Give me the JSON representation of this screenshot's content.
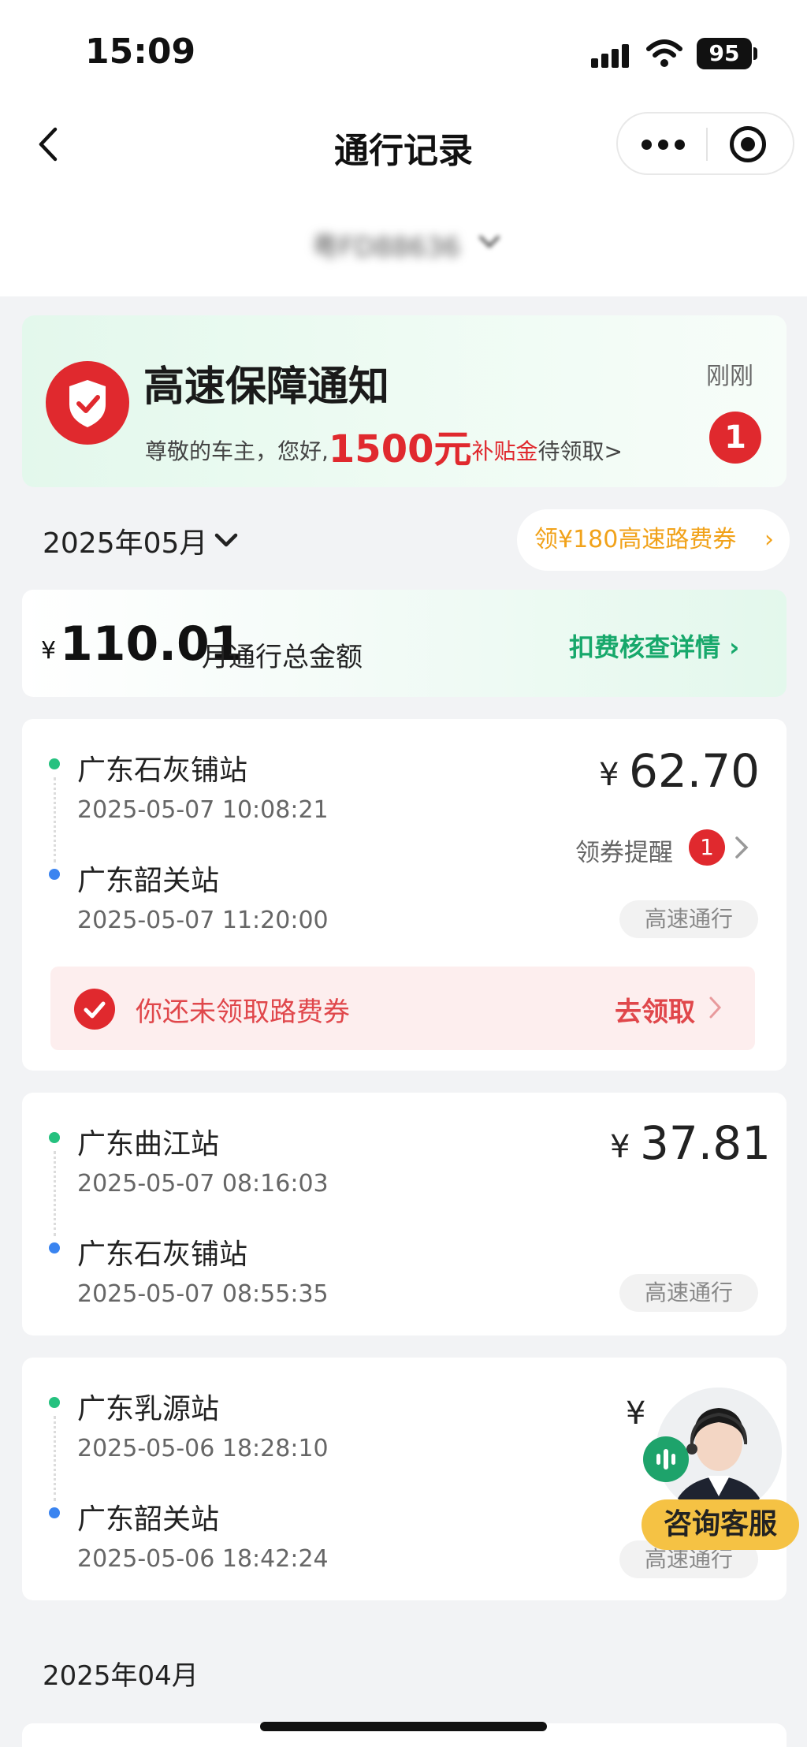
{
  "status_bar": {
    "time": "15:09",
    "battery": "95"
  },
  "header": {
    "title": "通行记录",
    "plate": "粤FD88636"
  },
  "notice": {
    "title": "高速保障通知",
    "sub_prefix": "尊敬的车主，您好,",
    "amount": "1500元",
    "sub_red": "补贴金",
    "sub_suffix": "待领取>",
    "time": "刚刚",
    "badge": "1"
  },
  "month": {
    "label": "2025年05月",
    "coupon": "领¥180高速路费券",
    "coupon_arrow": "›"
  },
  "summary": {
    "yen": "¥",
    "amount": "110.01",
    "label": "月通行总金额",
    "detail": "扣费核查详情 ›"
  },
  "records": [
    {
      "entry_station": "广东石灰铺站",
      "entry_time": "2025-05-07 10:08:21",
      "exit_station": "广东韶关站",
      "exit_time": "2025-05-07 11:20:00",
      "yen": "¥",
      "fee": "62.70",
      "tag": "高速通行",
      "remind_label": "领券提醒",
      "remind_badge": "1"
    },
    {
      "entry_station": "广东曲江站",
      "entry_time": "2025-05-07 08:16:03",
      "exit_station": "广东石灰铺站",
      "exit_time": "2025-05-07 08:55:35",
      "yen": "¥",
      "fee": "37.81",
      "tag": "高速通行"
    },
    {
      "entry_station": "广东乳源站",
      "entry_time": "2025-05-06 18:28:10",
      "exit_station": "广东韶关站",
      "exit_time": "2025-05-06 18:42:24",
      "yen": "¥",
      "fee": "",
      "tag": "高速通行"
    }
  ],
  "unclaimed": {
    "text": "你还未领取路费券",
    "action": "去领取"
  },
  "customer_service": {
    "label": "咨询客服"
  },
  "next_month": {
    "label": "2025年04月"
  },
  "colors": {
    "accent_green": "#17a86b",
    "alert_red": "#e0292e",
    "coupon_orange": "#f1a21a",
    "cs_yellow": "#f5c244"
  }
}
